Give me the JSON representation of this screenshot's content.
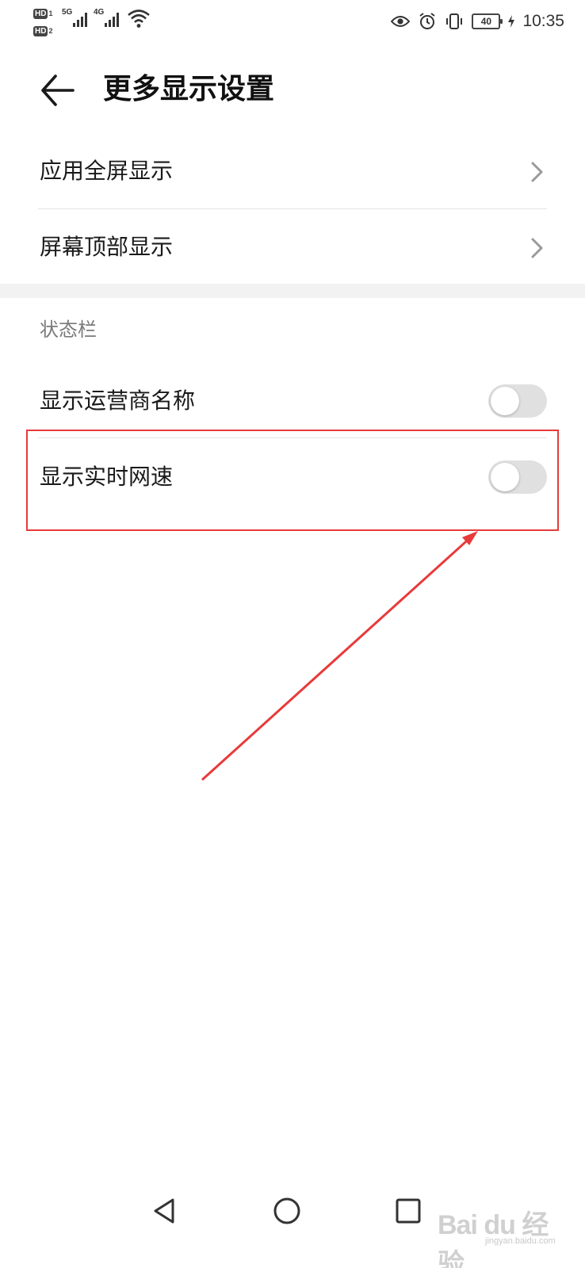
{
  "status_bar": {
    "hd1": "HD",
    "hd1_sub": "1",
    "hd2": "HD",
    "hd2_sub": "2",
    "network1": "5G",
    "network2": "4G",
    "battery": "40",
    "time": "10:35"
  },
  "header": {
    "title": "更多显示设置",
    "back_icon": "arrow-left-icon"
  },
  "display_items": [
    {
      "label": "应用全屏显示",
      "icon": "chevron-right-icon"
    },
    {
      "label": "屏幕顶部显示",
      "icon": "chevron-right-icon"
    }
  ],
  "status_bar_section": {
    "header": "状态栏",
    "items": [
      {
        "label": "显示运营商名称",
        "enabled": false
      },
      {
        "label": "显示实时网速",
        "enabled": false
      }
    ]
  },
  "nav_bar": {
    "back_icon": "triangle-back-icon",
    "home_icon": "circle-home-icon",
    "recents_icon": "square-recents-icon"
  },
  "watermark": {
    "text": "Bai du 经验",
    "sub": "jingyan.baidu.com"
  },
  "colors": {
    "annotation": "#e83a3a",
    "toggle_off": "#e0e0e0"
  }
}
